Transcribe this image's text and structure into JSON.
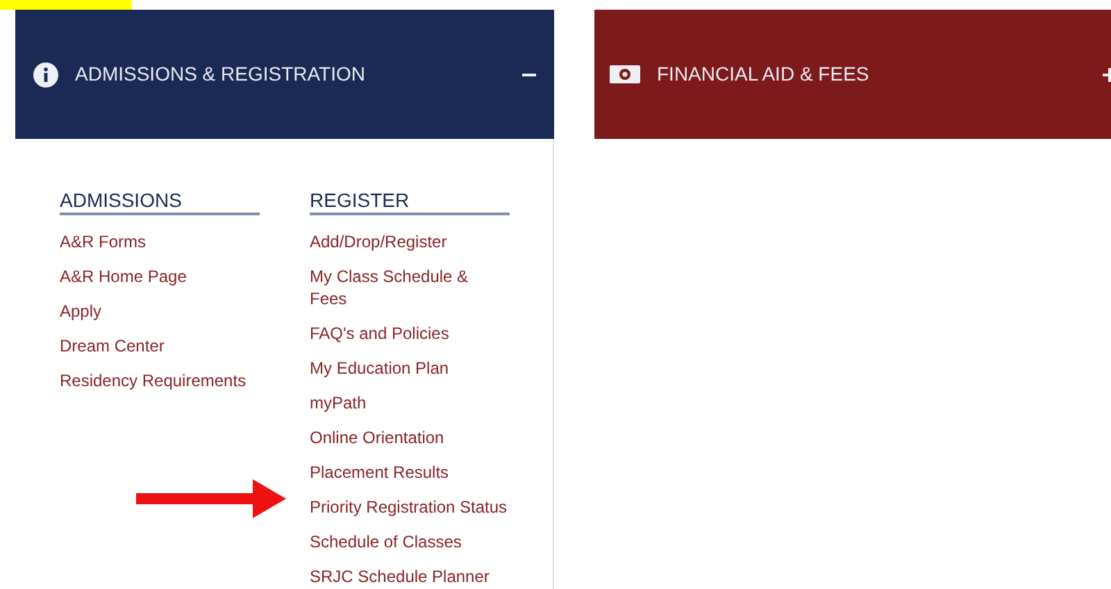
{
  "panels": [
    {
      "title": "ADMISSIONS & REGISTRATION",
      "kind": "info",
      "expanded": true,
      "color": "#1b2a55"
    },
    {
      "title": "FINANCIAL AID & FEES",
      "kind": "money",
      "expanded": false,
      "color": "#7d1a1c"
    }
  ],
  "columns": [
    {
      "heading": "ADMISSIONS",
      "links": [
        "A&R Forms",
        "A&R Home Page",
        "Apply",
        "Dream Center",
        "Residency Requirements"
      ]
    },
    {
      "heading": "REGISTER",
      "links": [
        "Add/Drop/Register",
        "My Class Schedule & Fees",
        "FAQ's and Policies",
        "My Education Plan",
        "myPath",
        "Online Orientation",
        "Placement Results",
        "Priority Registration Status",
        "Schedule of Classes",
        "SRJC Schedule Planner"
      ]
    }
  ]
}
